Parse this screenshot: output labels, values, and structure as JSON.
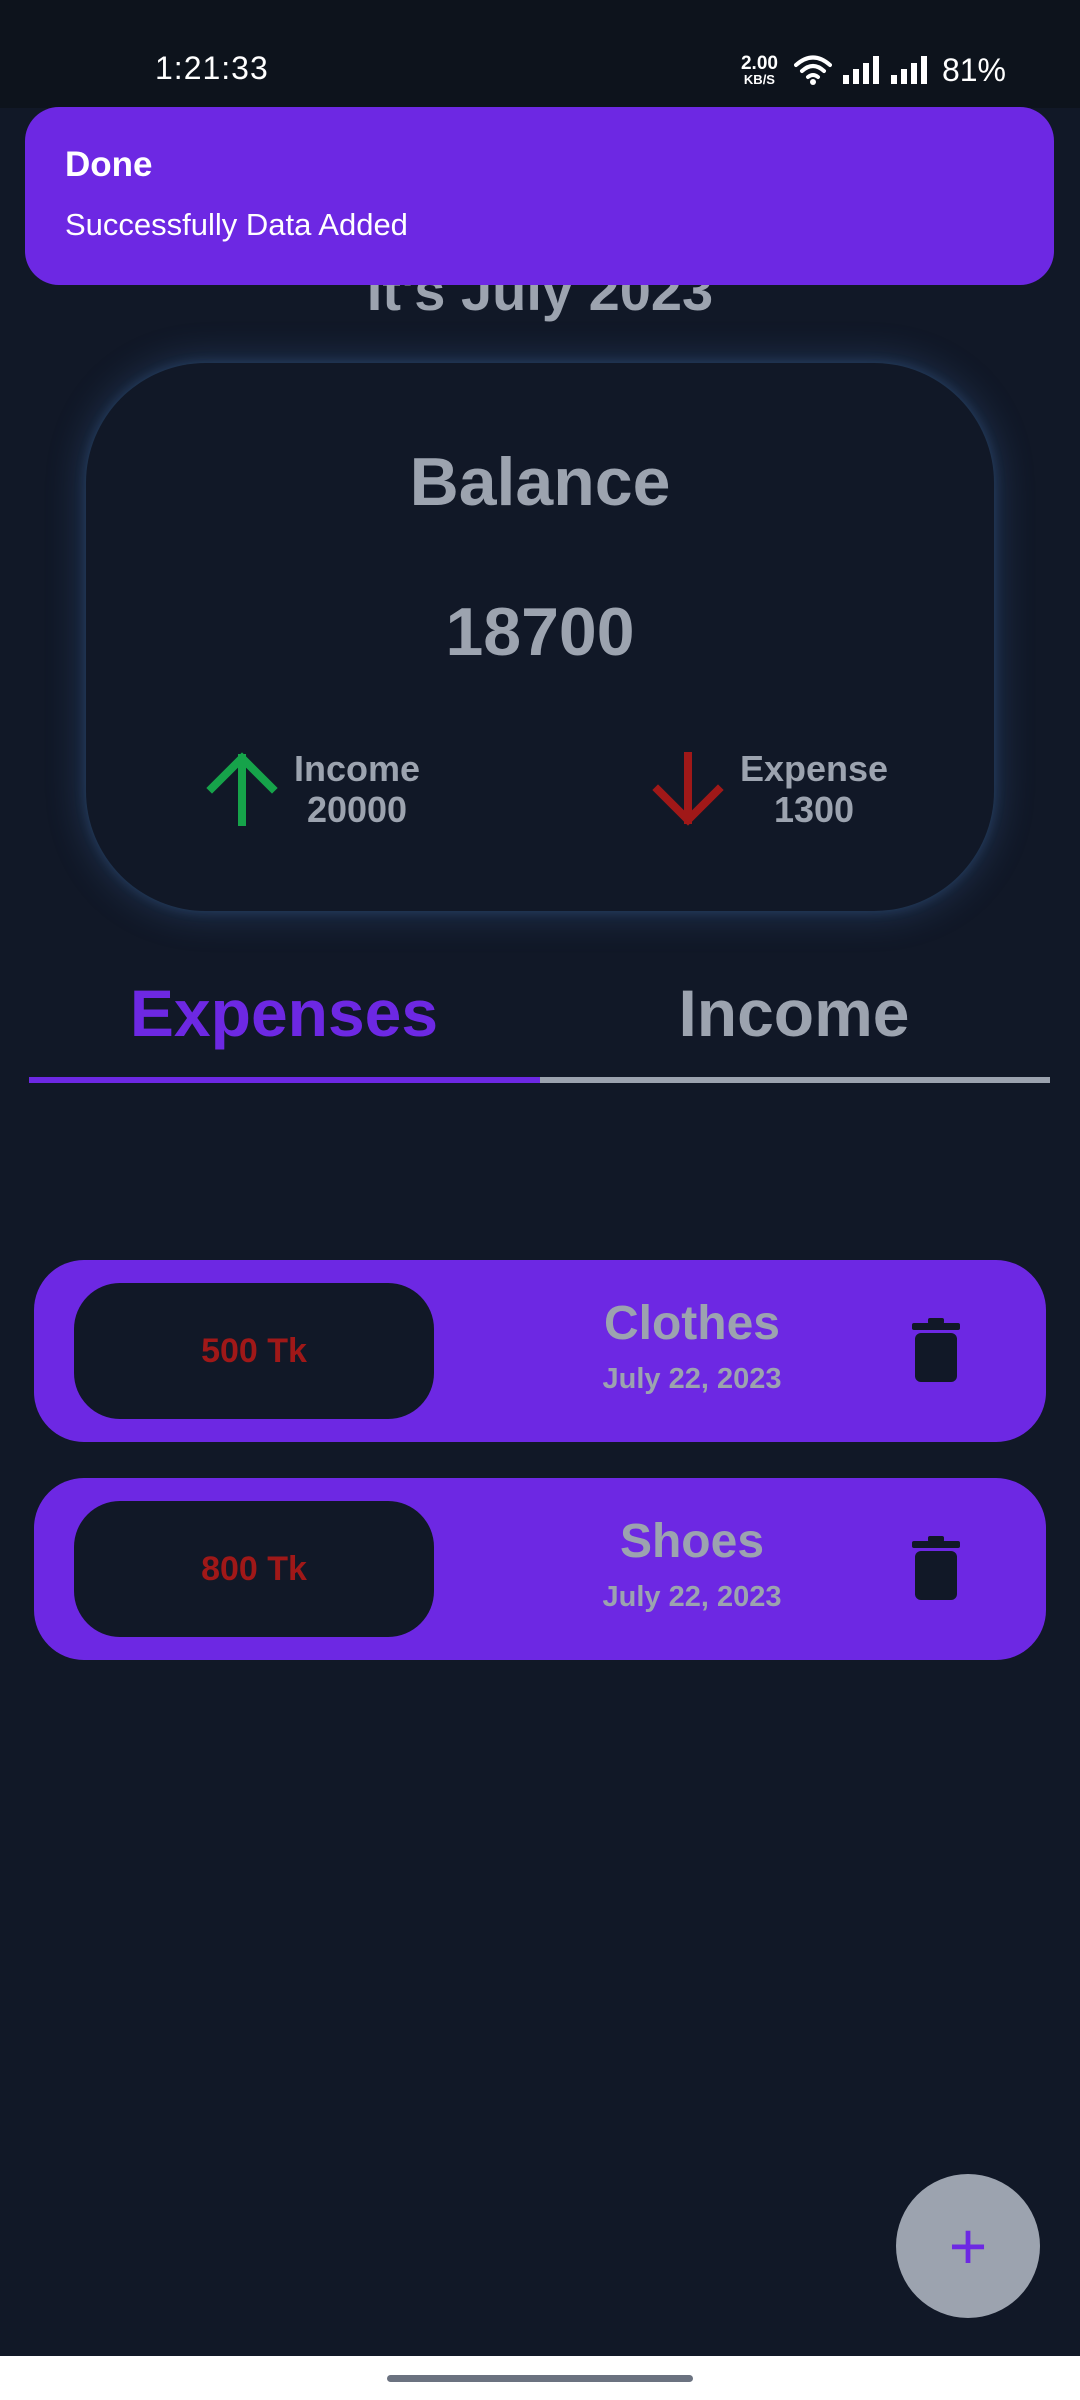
{
  "status_bar": {
    "time": "1:21:33",
    "net_speed_value": "2.00",
    "net_speed_unit": "KB/S",
    "battery": "81%"
  },
  "toast": {
    "title": "Done",
    "message": "Successfully Data Added"
  },
  "header": {
    "month_title": "It's July 2023"
  },
  "balance": {
    "label": "Balance",
    "value": "18700",
    "income_label": "Income",
    "income_value": "20000",
    "expense_label": "Expense",
    "expense_value": "1300"
  },
  "tabs": [
    {
      "label": "Expenses",
      "active": true
    },
    {
      "label": "Income",
      "active": false
    }
  ],
  "expenses": [
    {
      "amount": "500 Tk",
      "name": "Clothes",
      "date": "July 22, 2023"
    },
    {
      "amount": "800 Tk",
      "name": "Shoes",
      "date": "July 22, 2023"
    }
  ],
  "fab": {
    "label": "+"
  },
  "colors": {
    "background": "#111827",
    "accent": "#6d28e3",
    "text_muted": "#9ca3af",
    "income_arrow": "#16a34a",
    "expense_arrow": "#a01818"
  },
  "icons": {
    "income": "arrow-up-icon",
    "expense": "arrow-down-icon",
    "delete": "trash-icon",
    "wifi": "wifi-icon",
    "signal": "signal-icon"
  }
}
